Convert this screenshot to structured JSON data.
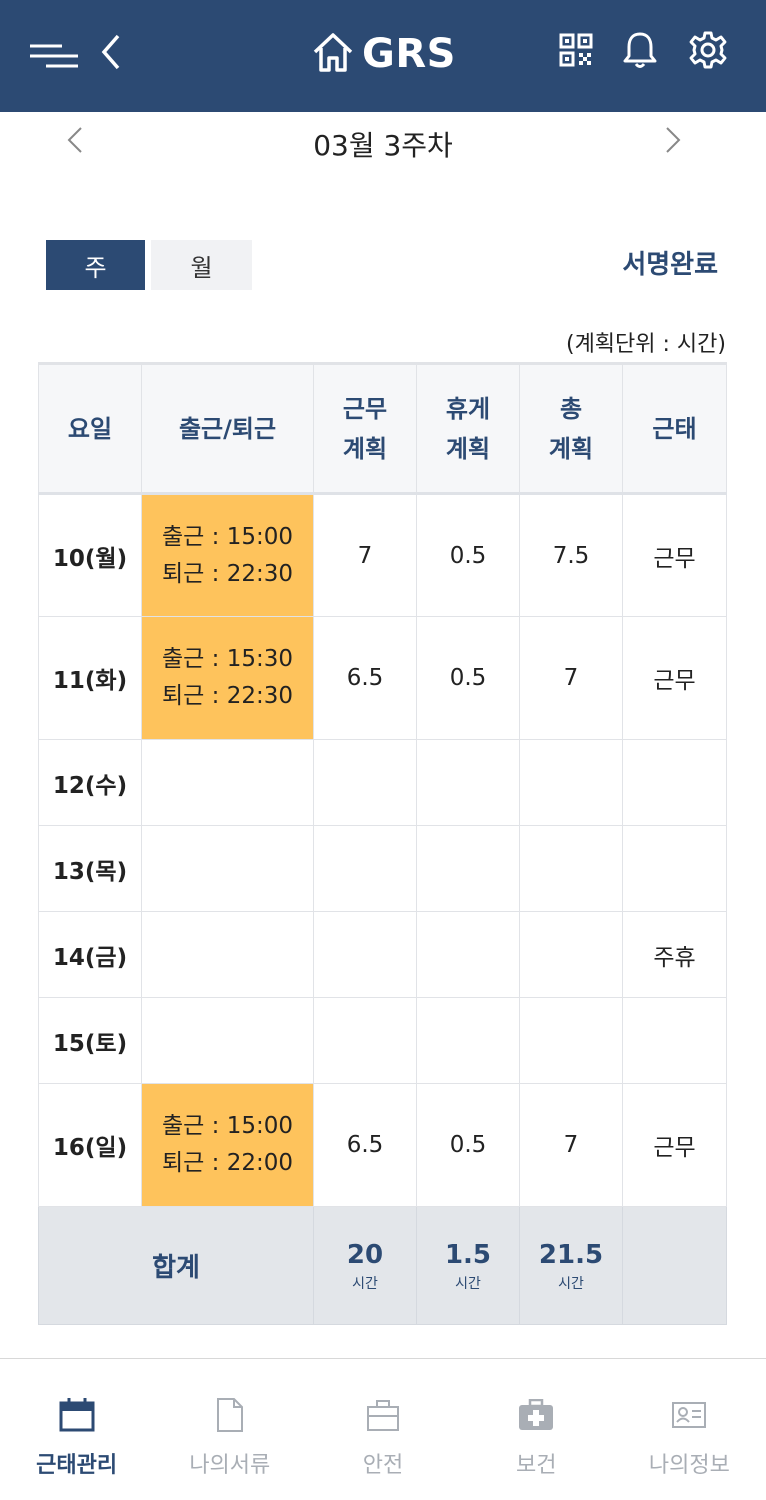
{
  "header": {
    "title": "GRS",
    "icons": [
      "menu-icon",
      "back-icon",
      "home-icon",
      "qr-code-icon",
      "bell-icon",
      "gear-icon"
    ]
  },
  "week_nav": {
    "label": "03월 3주차"
  },
  "view_toggle": {
    "week_label": "주",
    "month_label": "월",
    "selected": "주"
  },
  "sign_status": "서명완료",
  "unit_note": "(계획단위 : 시간)",
  "table": {
    "headers": {
      "day": "요일",
      "shift": "출근/퇴근",
      "work_plan_1": "근무",
      "work_plan_2": "계획",
      "break_plan_1": "휴게",
      "break_plan_2": "계획",
      "total_plan_1": "총",
      "total_plan_2": "계획",
      "attendance": "근태"
    },
    "rows": [
      {
        "day": "10(월)",
        "in": "출근 : 15:00",
        "out": "퇴근 : 22:30",
        "work": "7",
        "break": "0.5",
        "total": "7.5",
        "status": "근무"
      },
      {
        "day": "11(화)",
        "in": "출근 : 15:30",
        "out": "퇴근 : 22:30",
        "work": "6.5",
        "break": "0.5",
        "total": "7",
        "status": "근무"
      },
      {
        "day": "12(수)",
        "in": "",
        "out": "",
        "work": "",
        "break": "",
        "total": "",
        "status": ""
      },
      {
        "day": "13(목)",
        "in": "",
        "out": "",
        "work": "",
        "break": "",
        "total": "",
        "status": ""
      },
      {
        "day": "14(금)",
        "in": "",
        "out": "",
        "work": "",
        "break": "",
        "total": "",
        "status": "주휴"
      },
      {
        "day": "15(토)",
        "in": "",
        "out": "",
        "work": "",
        "break": "",
        "total": "",
        "status": ""
      },
      {
        "day": "16(일)",
        "in": "출근 : 15:00",
        "out": "퇴근 : 22:00",
        "work": "6.5",
        "break": "0.5",
        "total": "7",
        "status": "근무"
      }
    ],
    "totals": {
      "label": "합계",
      "work": "20",
      "break": "1.5",
      "total": "21.5",
      "unit": "시간"
    }
  },
  "bottom_nav": {
    "items": [
      {
        "label": "근태관리",
        "icon": "calendar-icon",
        "active": true
      },
      {
        "label": "나의서류",
        "icon": "document-icon",
        "active": false
      },
      {
        "label": "안전",
        "icon": "briefcase-icon",
        "active": false
      },
      {
        "label": "보건",
        "icon": "first-aid-kit-icon",
        "active": false
      },
      {
        "label": "나의정보",
        "icon": "id-card-icon",
        "active": false
      }
    ]
  },
  "colors": {
    "primary": "#2c4a73",
    "shift_highlight": "#fec35c",
    "total_row_bg": "#e3e6ea",
    "header_bg": "#f6f7f9",
    "inactive_nav": "#a9aeb5"
  }
}
